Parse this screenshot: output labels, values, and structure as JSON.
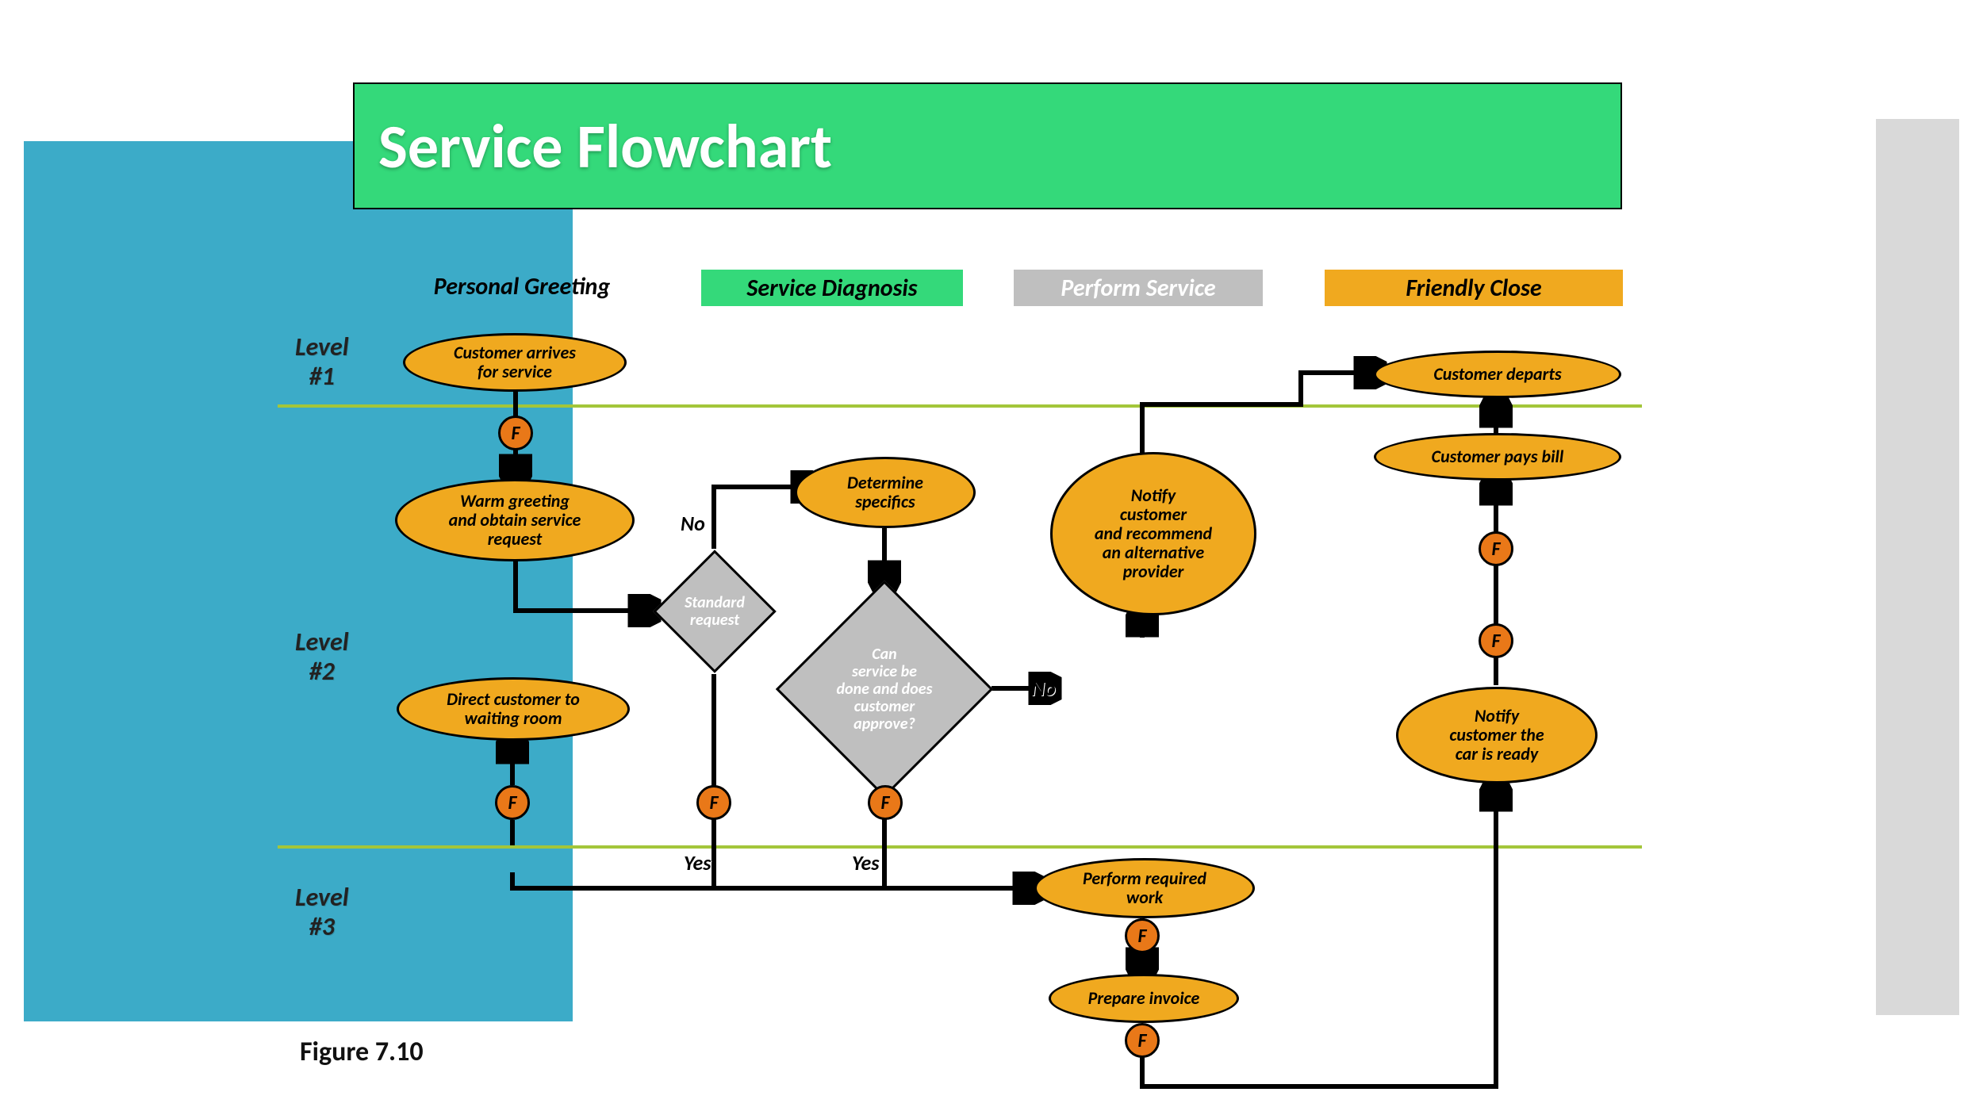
{
  "title": "Service Flowchart",
  "columns": {
    "personal_greeting": "Personal Greeting",
    "service_diagnosis": "Service Diagnosis",
    "perform_service": "Perform Service",
    "friendly_close": "Friendly Close"
  },
  "levels": {
    "l1": "Level\n#1",
    "l2": "Level\n#2",
    "l3": "Level\n#3"
  },
  "nodes": {
    "customer_arrives": "Customer arrives\nfor service",
    "warm_greeting": "Warm greeting\nand obtain service\nrequest",
    "direct_waiting": "Direct customer to\nwaiting room",
    "standard_request": "Standard\nrequest",
    "determine_specifics": "Determine\nspecifics",
    "can_service": "Can\nservice be\ndone and does\ncustomer\napprove?",
    "notify_alternative": "Notify\ncustomer\nand recommend\nan alternative\nprovider",
    "perform_work": "Perform required\nwork",
    "prepare_invoice": "Prepare invoice",
    "notify_ready": "Notify\ncustomer the\ncar is ready",
    "customer_pays": "Customer pays bill",
    "customer_departs": "Customer departs"
  },
  "edge_labels": {
    "no1": "No",
    "no2": "No",
    "yes1": "Yes",
    "yes2": "Yes"
  },
  "fail_marker": "F",
  "figure": "Figure 7.10",
  "colors": {
    "title_bg": "#34d97a",
    "blue_block": "#3cabc8",
    "amber": "#f0a91f",
    "orange": "#e97818",
    "gray": "#bfbfbf",
    "divider": "#a3c63a"
  }
}
